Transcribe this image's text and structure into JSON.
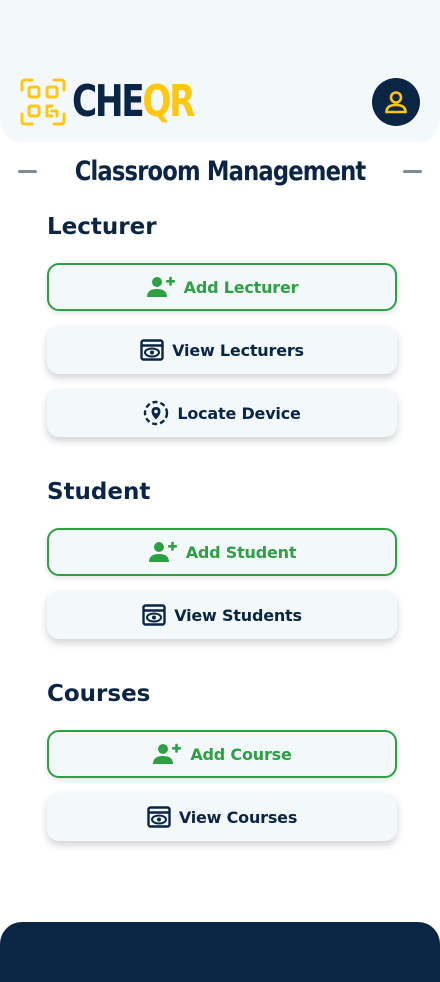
{
  "brand": {
    "part1": "CHE",
    "part2": "QR"
  },
  "page_title": "Classroom Management",
  "sections": {
    "lecturer": {
      "title": "Lecturer",
      "add": "Add Lecturer",
      "view": "View Lecturers",
      "locate": "Locate Device"
    },
    "student": {
      "title": "Student",
      "add": "Add Student",
      "view": "View Students"
    },
    "courses": {
      "title": "Courses",
      "add": "Add Course",
      "view": "View Courses"
    }
  },
  "icons": {
    "logo": "qr-code-icon",
    "profile": "user-icon",
    "add": "user-plus-icon",
    "view": "eye-icon",
    "locate": "location-pin-icon"
  },
  "colors": {
    "navy": "#0b2545",
    "yellow": "#ffc712",
    "green": "#2ea043",
    "surface": "#f3f8fb",
    "rule": "#7d8b96"
  }
}
